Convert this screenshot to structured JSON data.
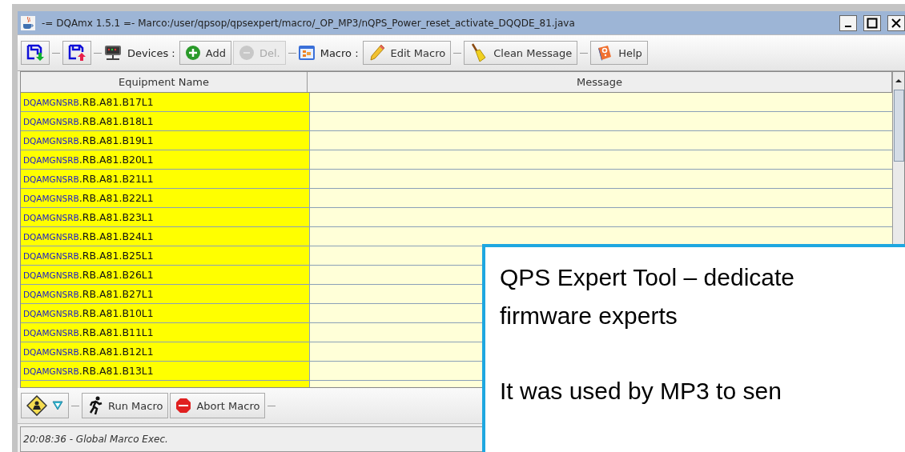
{
  "window": {
    "title": "-= DQAmx 1.5.1 =-  Marco:/user/qpsop/qpsexpert/macro/_OP_MP3/nQPS_Power_reset_activate_DQQDE_81.java"
  },
  "toolbar": [
    {
      "kind": "icon_button",
      "disabled": false
    },
    {
      "kind": "separator"
    },
    {
      "kind": "icon_button",
      "disabled": false
    },
    {
      "kind": "separator"
    },
    {
      "kind": "label",
      "label": "Devices :"
    },
    {
      "kind": "button",
      "label": "Add",
      "disabled": false
    },
    {
      "kind": "button",
      "label": "Del.",
      "disabled": true
    },
    {
      "kind": "separator"
    },
    {
      "kind": "label",
      "label": "Macro :"
    },
    {
      "kind": "button",
      "label": "Edit Macro",
      "disabled": false
    },
    {
      "kind": "separator"
    },
    {
      "kind": "button",
      "label": "Clean Message",
      "disabled": false
    },
    {
      "kind": "separator"
    },
    {
      "kind": "button",
      "label": "Help",
      "disabled": false
    }
  ],
  "table": {
    "columns": [
      "Equipment Name",
      "Message"
    ],
    "rows": [
      {
        "prefix": "DQAMGNSRB",
        "name": ".RB.A81.B17L1"
      },
      {
        "prefix": "DQAMGNSRB",
        "name": ".RB.A81.B18L1"
      },
      {
        "prefix": "DQAMGNSRB",
        "name": ".RB.A81.B19L1"
      },
      {
        "prefix": "DQAMGNSRB",
        "name": ".RB.A81.B20L1"
      },
      {
        "prefix": "DQAMGNSRB",
        "name": ".RB.A81.B21L1"
      },
      {
        "prefix": "DQAMGNSRB",
        "name": ".RB.A81.B22L1"
      },
      {
        "prefix": "DQAMGNSRB",
        "name": ".RB.A81.B23L1"
      },
      {
        "prefix": "DQAMGNSRB",
        "name": ".RB.A81.B24L1"
      },
      {
        "prefix": "DQAMGNSRB",
        "name": ".RB.A81.B25L1"
      },
      {
        "prefix": "DQAMGNSRB",
        "name": ".RB.A81.B26L1"
      },
      {
        "prefix": "DQAMGNSRB",
        "name": ".RB.A81.B27L1"
      },
      {
        "prefix": "DQAMGNSRB",
        "name": ".RB.A81.B10L1"
      },
      {
        "prefix": "DQAMGNSRB",
        "name": ".RB.A81.B11L1"
      },
      {
        "prefix": "DQAMGNSRB",
        "name": ".RB.A81.B12L1"
      },
      {
        "prefix": "DQAMGNSRB",
        "name": ".RB.A81.B13L1"
      }
    ]
  },
  "bottom_toolbar": [
    {
      "kind": "dropdown_button",
      "disabled": false
    },
    {
      "kind": "separator"
    },
    {
      "kind": "button",
      "label": "Run Macro",
      "disabled": false
    },
    {
      "kind": "button",
      "label": "Abort Macro",
      "disabled": false
    },
    {
      "kind": "separator"
    }
  ],
  "status_bar": {
    "text": "20:08:36 - Global Marco Exec."
  },
  "callout": {
    "paragraphs": [
      [
        "QPS Expert Tool – dedicate",
        "firmware experts"
      ],
      [
        "It was used by MP3 to sen"
      ]
    ]
  }
}
